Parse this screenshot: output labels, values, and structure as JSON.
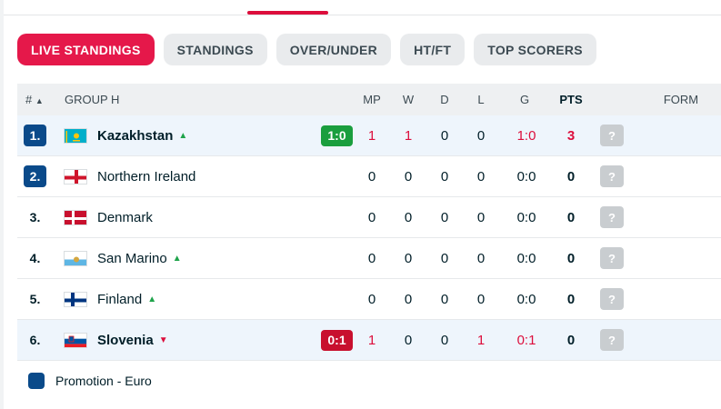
{
  "tabs": [
    "LIVE STANDINGS",
    "STANDINGS",
    "OVER/UNDER",
    "HT/FT",
    "TOP SCORERS"
  ],
  "header": {
    "rank": "#",
    "rank_sort": "▲",
    "group": "GROUP H",
    "mp": "MP",
    "w": "W",
    "d": "D",
    "l": "L",
    "g": "G",
    "pts": "PTS",
    "form": "FORM"
  },
  "rows": [
    {
      "rank": "1.",
      "team": "Kazakhstan",
      "trend": "up",
      "live": "1:0",
      "live_result": "win",
      "mp": "1",
      "w": "1",
      "d": "0",
      "l": "0",
      "g": "1:0",
      "pts": "3",
      "form": "?"
    },
    {
      "rank": "2.",
      "team": "Northern Ireland",
      "trend": "",
      "live": "",
      "live_result": "",
      "mp": "0",
      "w": "0",
      "d": "0",
      "l": "0",
      "g": "0:0",
      "pts": "0",
      "form": "?"
    },
    {
      "rank": "3.",
      "team": "Denmark",
      "trend": "",
      "live": "",
      "live_result": "",
      "mp": "0",
      "w": "0",
      "d": "0",
      "l": "0",
      "g": "0:0",
      "pts": "0",
      "form": "?"
    },
    {
      "rank": "4.",
      "team": "San Marino",
      "trend": "up",
      "live": "",
      "live_result": "",
      "mp": "0",
      "w": "0",
      "d": "0",
      "l": "0",
      "g": "0:0",
      "pts": "0",
      "form": "?"
    },
    {
      "rank": "5.",
      "team": "Finland",
      "trend": "up",
      "live": "",
      "live_result": "",
      "mp": "0",
      "w": "0",
      "d": "0",
      "l": "0",
      "g": "0:0",
      "pts": "0",
      "form": "?"
    },
    {
      "rank": "6.",
      "team": "Slovenia",
      "trend": "down",
      "live": "0:1",
      "live_result": "loss",
      "mp": "1",
      "w": "0",
      "d": "0",
      "l": "1",
      "g": "0:1",
      "pts": "0",
      "form": "?"
    }
  ],
  "legend": {
    "label": "Promotion - Euro",
    "color": "#0a4a8a"
  },
  "colors": {
    "accent": "#e5184a",
    "promotion": "#0a4a8a",
    "win": "#1a9e3e",
    "loss": "#c8102e",
    "up": "#1ea34a",
    "down": "#dc0e3c"
  }
}
